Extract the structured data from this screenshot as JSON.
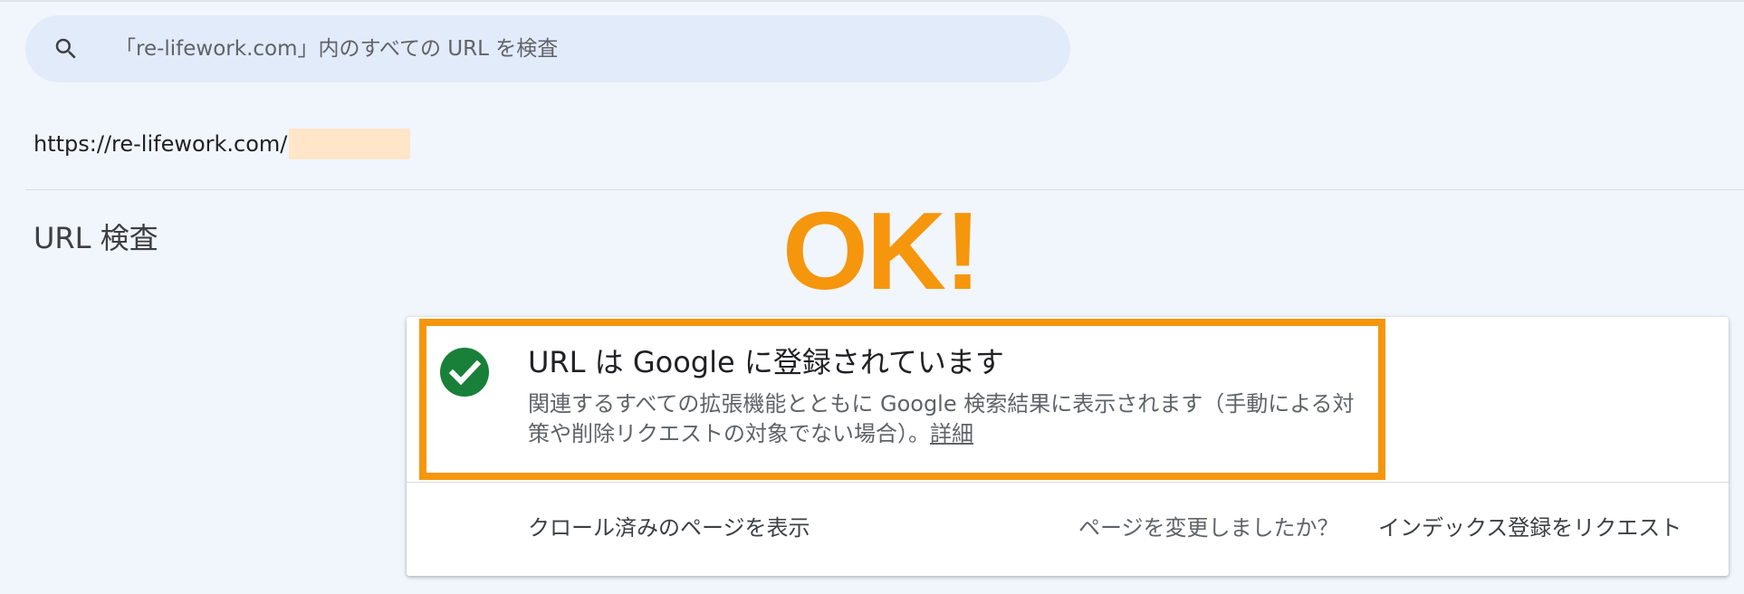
{
  "search": {
    "placeholder": "「re-lifework.com」内のすべての URL を検査",
    "icon": "search-icon"
  },
  "inspected_url": {
    "prefix": "https://re-lifework.com/"
  },
  "section": {
    "title": "URL 検査"
  },
  "annotation": {
    "ok_text": "OK!",
    "color": "#f5960c"
  },
  "status_card": {
    "icon": "check-circle-icon",
    "icon_color": "#188038",
    "title": "URL は Google に登録されています",
    "description": "関連するすべての拡張機能とともに Google 検索結果に表示されます（手動による対策や削除リクエストの対象でない場合）。",
    "details_link": "詳細",
    "crawled_page_link": "クロール済みのページを表示",
    "changed_question": "ページを変更しましたか？",
    "request_index_button": "インデックス登録をリクエスト"
  },
  "colors": {
    "background": "#f1f5fc",
    "search_bar": "#e2ebf9",
    "redaction": "#ffe6c8"
  }
}
